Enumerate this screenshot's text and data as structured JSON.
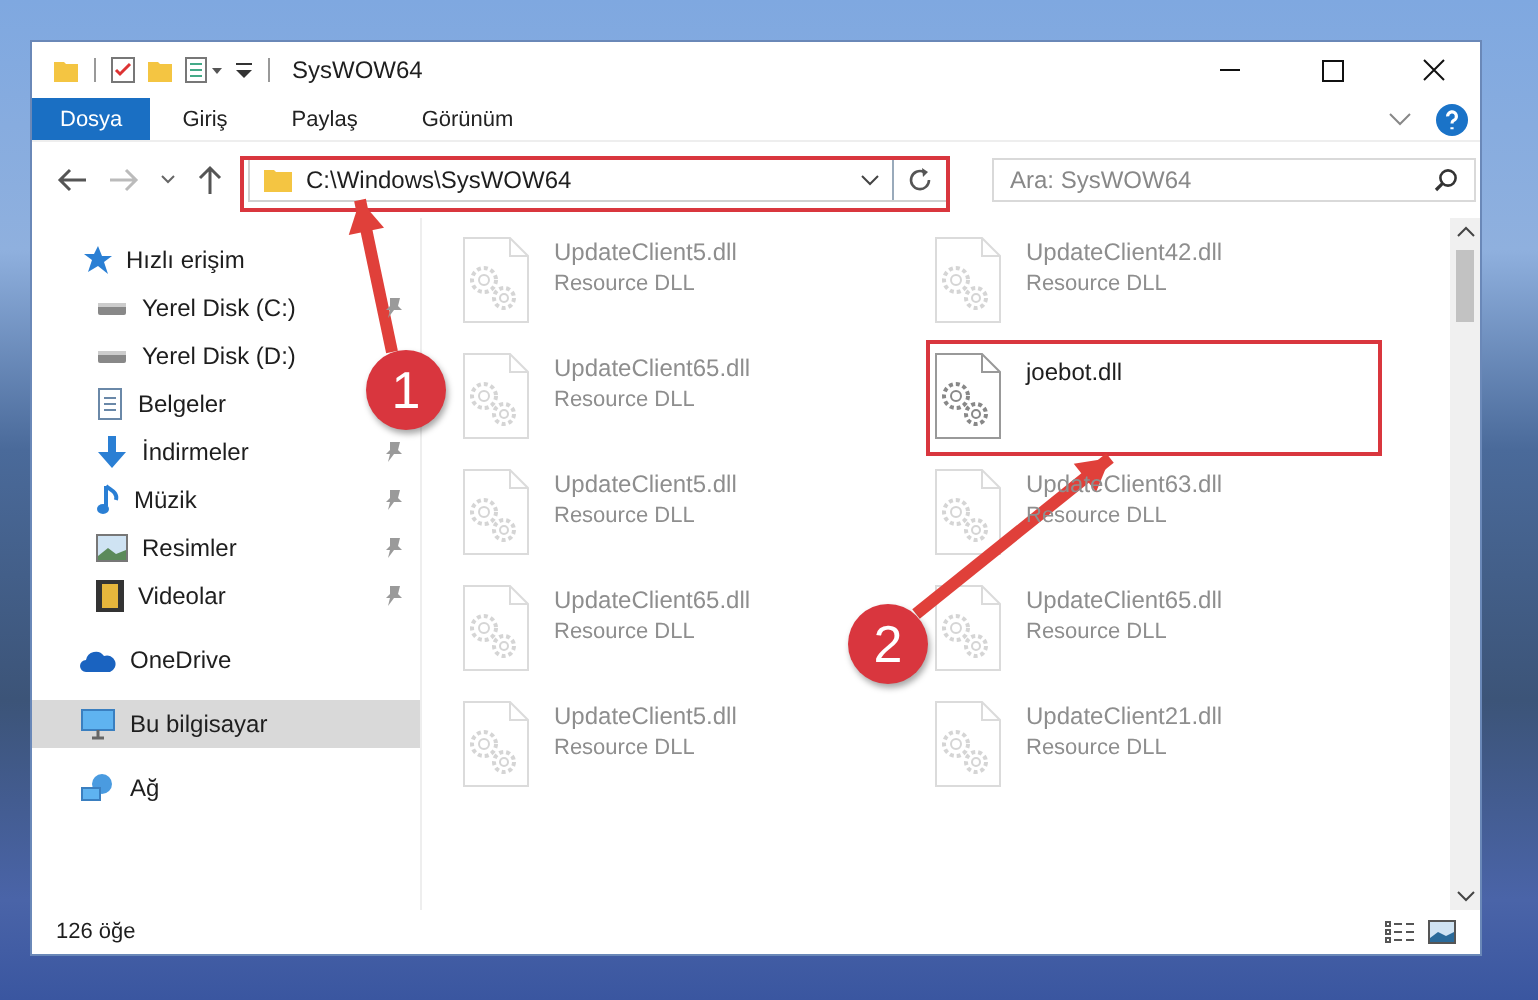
{
  "window": {
    "title": "SysWOW64"
  },
  "ribbon_tabs": [
    {
      "label": "Dosya",
      "kind": "file"
    },
    {
      "label": "Giriş",
      "kind": "tab"
    },
    {
      "label": "Paylaş",
      "kind": "tab"
    },
    {
      "label": "Görünüm",
      "kind": "tab"
    }
  ],
  "navigation": {
    "back_disabled": false,
    "forward_disabled": true
  },
  "address_bar": {
    "value": "C:\\Windows\\SysWOW64",
    "highlighted": true
  },
  "search": {
    "placeholder": "Ara: SysWOW64"
  },
  "sidebar": {
    "items": [
      {
        "label": "Hızlı erişim",
        "kind": "star",
        "selected": false,
        "pinned": false,
        "children": [
          {
            "label": "Yerel Disk (C:)",
            "kind": "drive",
            "selected": false,
            "pinned": true
          },
          {
            "label": "Yerel Disk (D:)",
            "kind": "drive",
            "selected": false,
            "pinned": false
          },
          {
            "label": "Belgeler",
            "kind": "document",
            "selected": false,
            "pinned": false
          },
          {
            "label": "İndirmeler",
            "kind": "download",
            "selected": false,
            "pinned": true
          },
          {
            "label": "Müzik",
            "kind": "music",
            "selected": false,
            "pinned": true
          },
          {
            "label": "Resimler",
            "kind": "picture",
            "selected": false,
            "pinned": true
          },
          {
            "label": "Videolar",
            "kind": "video",
            "selected": false,
            "pinned": true
          }
        ]
      },
      {
        "label": "OneDrive",
        "kind": "cloud",
        "selected": false,
        "pinned": false
      },
      {
        "label": "Bu bilgisayar",
        "kind": "computer",
        "selected": true,
        "pinned": false
      },
      {
        "label": "Ağ",
        "kind": "network",
        "selected": false,
        "pinned": false
      }
    ]
  },
  "files": [
    {
      "name": "UpdateClient5.dll",
      "type": "Resource DLL",
      "faded": true,
      "highlighted": false
    },
    {
      "name": "UpdateClient42.dll",
      "type": "Resource DLL",
      "faded": true,
      "highlighted": false
    },
    {
      "name": "UpdateClient65.dll",
      "type": "Resource DLL",
      "faded": true,
      "highlighted": false
    },
    {
      "name": "joebot.dll",
      "faded": false,
      "highlighted": true
    },
    {
      "name": "UpdateClient5.dll",
      "type": "Resource DLL",
      "faded": true,
      "highlighted": false
    },
    {
      "name": "UpdateClient63.dll",
      "type": "Resource DLL",
      "faded": true,
      "highlighted": false
    },
    {
      "name": "UpdateClient65.dll",
      "type": "Resource DLL",
      "faded": true,
      "highlighted": false
    },
    {
      "name": "UpdateClient65.dll",
      "type": "Resource DLL",
      "faded": true,
      "highlighted": false
    },
    {
      "name": "UpdateClient5.dll",
      "type": "Resource DLL",
      "faded": true,
      "highlighted": false
    },
    {
      "name": "UpdateClient21.dll",
      "type": "Resource DLL",
      "faded": true,
      "highlighted": false
    }
  ],
  "status_bar": {
    "item_count": "126 öğe"
  },
  "annotations": [
    {
      "label": "1"
    },
    {
      "label": "2"
    }
  ]
}
